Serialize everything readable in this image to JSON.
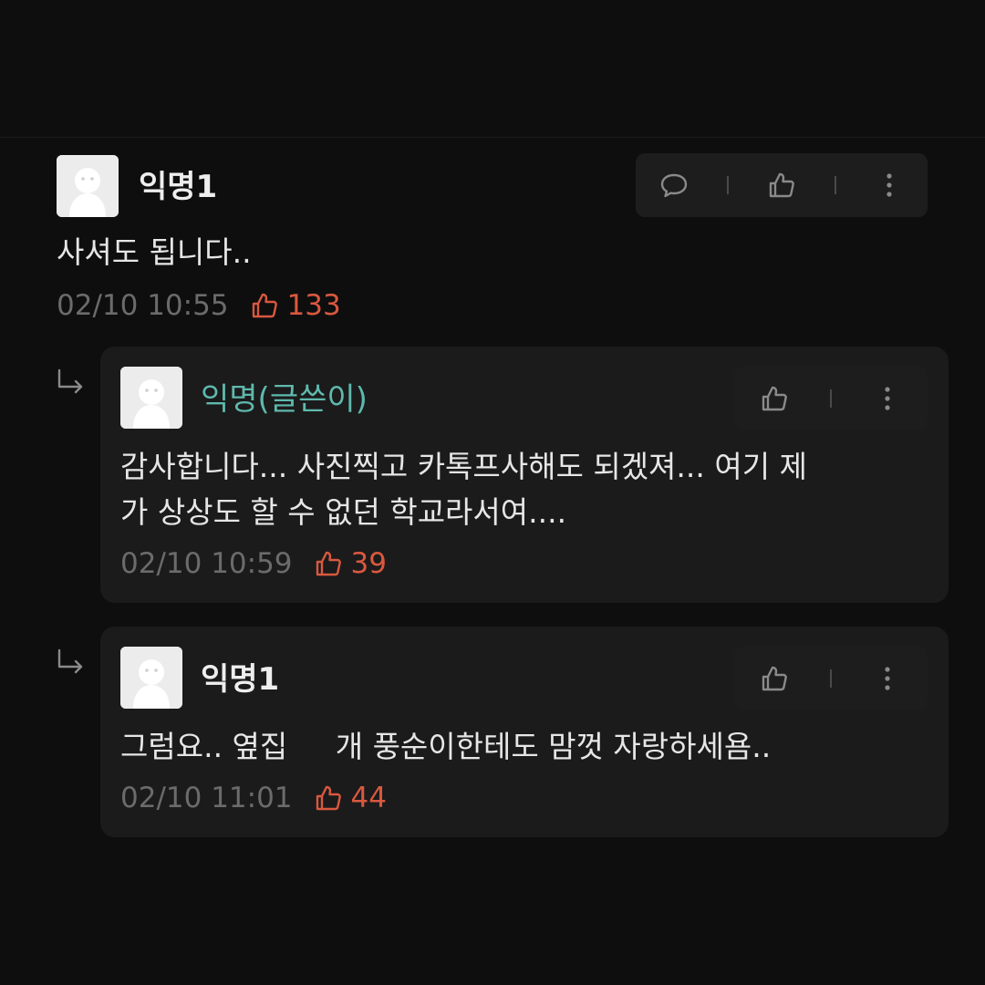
{
  "comments": [
    {
      "author": "익명1",
      "text": "사셔도 됩니다..",
      "time": "02/10 10:55",
      "likes": "133"
    }
  ],
  "replies": [
    {
      "author": "익명(글쓴이)",
      "is_op": true,
      "lines": [
        "감사합니다... 사진찍고 카톡프사해도 되겠져... 여기 제",
        "가 상상도 할 수 없던 학교라서여...."
      ],
      "time": "02/10 10:59",
      "likes": "39"
    },
    {
      "author": "익명1",
      "is_op": false,
      "lines": [
        "그럼요.. 옆집     개 풍순이한테도 맘껏 자랑하세욤.."
      ],
      "time": "02/10 11:01",
      "likes": "44"
    }
  ],
  "icons": {
    "reply": "speech-bubble-icon",
    "like": "thumbs-up-icon",
    "more": "more-vertical-icon"
  },
  "colors": {
    "background": "#0e0e0e",
    "card": "#1b1b1b",
    "op_name": "#5fb9ad",
    "like": "#d9583f",
    "timestamp": "#6b6b6b"
  }
}
